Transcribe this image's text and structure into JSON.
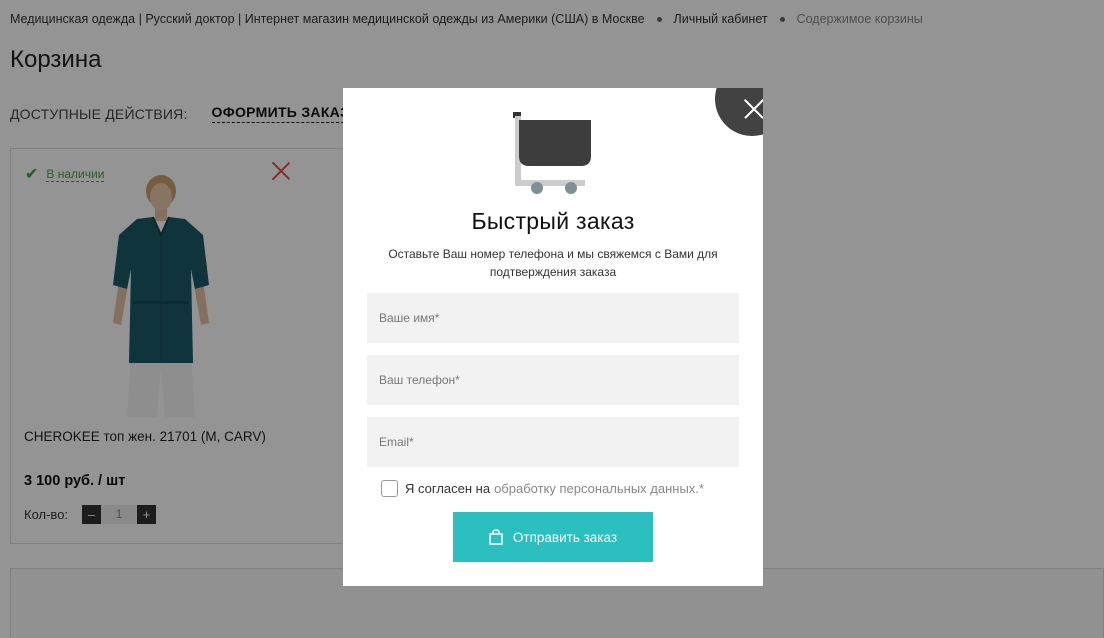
{
  "breadcrumb": {
    "items": [
      "Медицинская одежда | Русский доктор | Интернет магазин медицинской одежды из Америки (США) в Москве",
      "Личный кабинет"
    ],
    "current": "Содержимое корзины"
  },
  "page": {
    "title": "Корзина",
    "actions_label": "ДОСТУПНЫЕ ДЕЙСТВИЯ:",
    "order_link": "ОФОРМИТЬ ЗАКАЗ"
  },
  "product": {
    "stock_label": "В наличии",
    "name": "CHEROKEE топ жен. 21701 (M, CARV)",
    "price": "3 100 руб. / шт",
    "qty_label": "Кол-во:",
    "qty_minus": "–",
    "qty_value": "1",
    "qty_plus": "+"
  },
  "modal": {
    "title": "Быстрый заказ",
    "subtitle": "Оставьте Ваш номер телефона и мы свяжемся с Вами для подтверждения заказа",
    "name_placeholder": "Ваше имя*",
    "phone_placeholder": "Ваш телефон*",
    "email_placeholder": "Email*",
    "agree_prefix": "Я согласен на",
    "agree_link": "обработку персональных данных.",
    "agree_star": "*",
    "submit_label": "Отправить заказ"
  },
  "colors": {
    "accent": "#2cbfbf",
    "in_stock": "#4a9b4a",
    "remove": "#e0504a",
    "close_bg": "#424242",
    "scrub_top": "#1d5a66"
  },
  "icons": [
    "check-icon",
    "remove-icon",
    "close-icon",
    "cart-icon",
    "bag-icon"
  ]
}
